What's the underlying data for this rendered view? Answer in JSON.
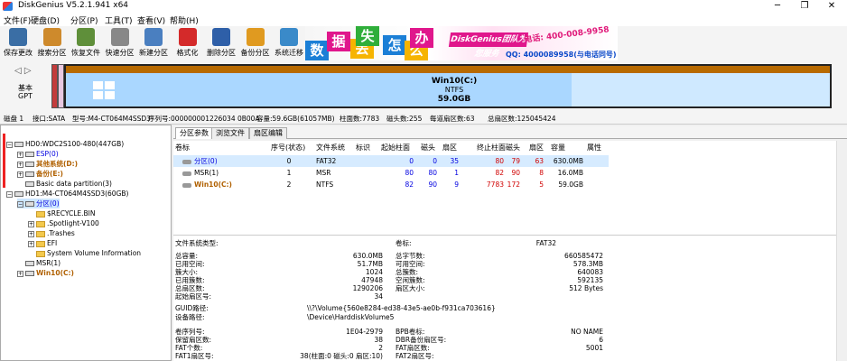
{
  "app": {
    "title": "DiskGenius V5.2.1.941 x64"
  },
  "menu": [
    "文件(F)",
    "硬盘(D)",
    "分区(P)",
    "工具(T)",
    "查看(V)",
    "帮助(H)"
  ],
  "toolbar": [
    {
      "label": "保存更改",
      "icon": "save-icon",
      "color": "#3a6ea5"
    },
    {
      "label": "搜索分区",
      "icon": "search-icon",
      "color": "#ce8a2c"
    },
    {
      "label": "恢复文件",
      "icon": "recover-icon",
      "color": "#5f8f3a"
    },
    {
      "label": "快速分区",
      "icon": "quick-partition-icon",
      "color": "#888888"
    },
    {
      "label": "新建分区",
      "icon": "new-partition-icon",
      "color": "#4a7fc0"
    },
    {
      "label": "格式化",
      "icon": "format-icon",
      "color": "#d42a2a"
    },
    {
      "label": "删除分区",
      "icon": "delete-icon",
      "color": "#2e5fa8"
    },
    {
      "label": "备份分区",
      "icon": "backup-icon",
      "color": "#e09a20"
    },
    {
      "label": "系统迁移",
      "icon": "migrate-icon",
      "color": "#3a8ac9"
    }
  ],
  "banner": {
    "chars": [
      {
        "t": "数",
        "c": "#1b7fd6"
      },
      {
        "t": "据",
        "c": "#e0178c"
      },
      {
        "t": "丢",
        "c": "#f6b400"
      },
      {
        "t": "失",
        "c": "#2fae3a"
      },
      {
        "t": "怎",
        "c": "#1b7fd6"
      },
      {
        "t": "么",
        "c": "#f6b400"
      },
      {
        "t": "办",
        "c": "#e0178c"
      }
    ],
    "text": "DiskGenius团队为您服务",
    "phone": "电话: 400-008-9958",
    "qq": "QQ: 4000089958(与电话同号)"
  },
  "diskmap": {
    "nav": "◁ ▷",
    "type_line1": "基本",
    "type_line2": "GPT",
    "partition": {
      "name": "Win10(C:)",
      "fs": "NTFS",
      "size": "59.0GB"
    }
  },
  "diskinfo": {
    "disk": "磁盘 1",
    "interface": "接口:SATA",
    "model": "型号:M4-CT064M4SSD3",
    "serial": "序列号:000000001226034 0B00A",
    "capacity": "容量:59.6GB(61057MB)",
    "cylinders": "柱面数:7783",
    "heads": "磁头数:255",
    "sectors_per_track": "每道扇区数:63",
    "total_sectors": "总扇区数:125045424"
  },
  "tree": [
    {
      "text": "HD0:WDC2S100-480(447GB)",
      "indent": 0,
      "tog": "−",
      "cls": "c-black",
      "icon": "disk"
    },
    {
      "text": "ESP(0)",
      "indent": 1,
      "tog": "+",
      "cls": "c-blue",
      "icon": "part"
    },
    {
      "text": "其他系统(D:)",
      "indent": 1,
      "tog": "+",
      "cls": "c-orange",
      "icon": "part"
    },
    {
      "text": "备份(E:)",
      "indent": 1,
      "tog": "+",
      "cls": "c-orange",
      "icon": "part"
    },
    {
      "text": "Basic data partition(3)",
      "indent": 1,
      "tog": "",
      "cls": "c-black",
      "icon": "part"
    },
    {
      "text": "HD1:M4-CT064M4SSD3(60GB)",
      "indent": 0,
      "tog": "−",
      "cls": "c-black",
      "icon": "disk"
    },
    {
      "text": "分区(0)",
      "indent": 1,
      "tog": "−",
      "cls": "c-blue",
      "icon": "part",
      "selected": true
    },
    {
      "text": "$RECYCLE.BIN",
      "indent": 2,
      "tog": "",
      "cls": "c-black",
      "icon": "folder"
    },
    {
      "text": ".Spotlight-V100",
      "indent": 2,
      "tog": "+",
      "cls": "c-black",
      "icon": "folder"
    },
    {
      "text": ".Trashes",
      "indent": 2,
      "tog": "+",
      "cls": "c-black",
      "icon": "folder"
    },
    {
      "text": "EFI",
      "indent": 2,
      "tog": "+",
      "cls": "c-black",
      "icon": "folder"
    },
    {
      "text": "System Volume Information",
      "indent": 2,
      "tog": "",
      "cls": "c-black",
      "icon": "folder"
    },
    {
      "text": "MSR(1)",
      "indent": 1,
      "tog": "",
      "cls": "c-black",
      "icon": "part"
    },
    {
      "text": "Win10(C:)",
      "indent": 1,
      "tog": "+",
      "cls": "c-orange",
      "icon": "part"
    }
  ],
  "tabs": [
    "分区参数",
    "浏览文件",
    "扇区编辑"
  ],
  "ptable": {
    "headers": [
      "卷标",
      "序号(状态)",
      "文件系统",
      "标识",
      "起始柱面",
      "磁头",
      "扇区",
      "终止柱面",
      "磁头",
      "扇区",
      "容量",
      "属性"
    ],
    "rows": [
      [
        "分区(0)",
        "0",
        "FAT32",
        "",
        "0",
        "0",
        "35",
        "80",
        "79",
        "63",
        "630.0MB",
        ""
      ],
      [
        "MSR(1)",
        "1",
        "MSR",
        "",
        "80",
        "80",
        "1",
        "82",
        "90",
        "8",
        "16.0MB",
        ""
      ],
      [
        "Win10(C:)",
        "2",
        "NTFS",
        "",
        "82",
        "90",
        "9",
        "7783",
        "172",
        "5",
        "59.0GB",
        ""
      ]
    ]
  },
  "details": {
    "fs_type_label": "文件系统类型:",
    "fs_type_value": "FAT32",
    "vol_label_label": "卷标:",
    "left": [
      [
        "总容量:",
        "630.0MB"
      ],
      [
        "已用空间:",
        "51.7MB"
      ],
      [
        "簇大小:",
        "1024"
      ],
      [
        "已用簇数:",
        "47948"
      ],
      [
        "总扇区数:",
        "1290206"
      ],
      [
        "起始扇区号:",
        "34"
      ]
    ],
    "right": [
      [
        "总字节数:",
        "660585472"
      ],
      [
        "可用空间:",
        "578.3MB"
      ],
      [
        "总簇数:",
        "640083"
      ],
      [
        "空闲簇数:",
        "592135"
      ],
      [
        "扇区大小:",
        "512 Bytes"
      ]
    ],
    "guid_label": "GUID路径:",
    "guid_value": "\\\\?\\Volume{560e8284-ed38-43e5-ae0b-f931ca703616}",
    "dev_label": "设备路径:",
    "dev_value": "\\Device\\HarddiskVolume5",
    "bottom_left": [
      [
        "卷序列号:",
        "1E04-2979"
      ],
      [
        "保留扇区数:",
        "38"
      ],
      [
        "FAT个数:",
        "2"
      ],
      [
        "FAT1扇区号:",
        "38(柱面:0 磁头:0 扇区:10)"
      ]
    ],
    "bottom_right": [
      [
        "BPB卷标:",
        "NO NAME"
      ],
      [
        "DBR备份扇区号:",
        "6"
      ],
      [
        "FAT扇区数:",
        "5001"
      ],
      [
        "FAT2扇区号:",
        ""
      ]
    ]
  }
}
